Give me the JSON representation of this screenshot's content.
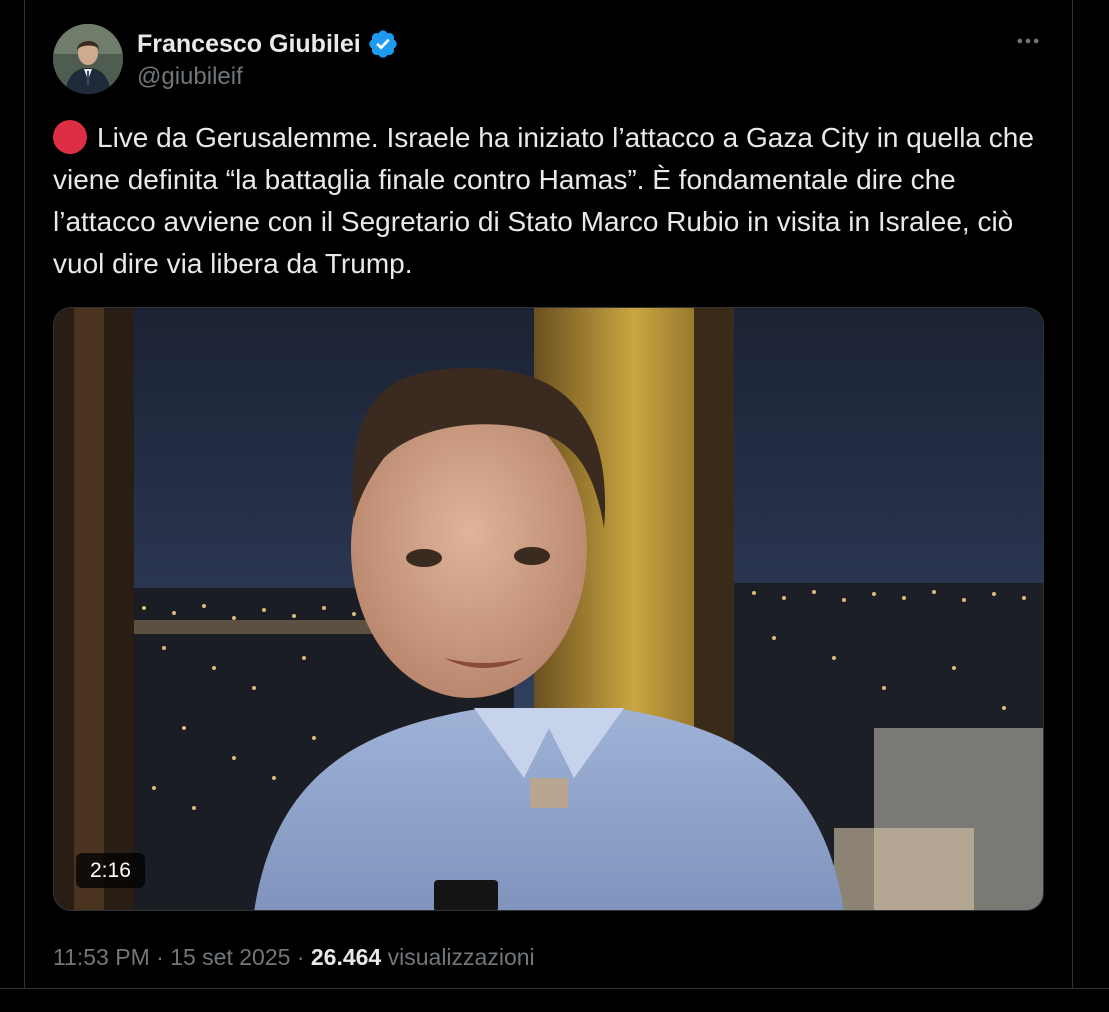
{
  "author": {
    "name": "Francesco Giubilei",
    "handle": "@giubileif",
    "verified": true
  },
  "post": {
    "text": "Live da Gerusalemme. Israele ha iniziato l’attacco a Gaza City in quella che viene definita “la battaglia finale contro Hamas”. È fondamentale dire che l’attacco avviene con il Segretario di Stato Marco Rubio in visita in Isralee, ciò vuol dire via libera da Trump.",
    "leading_emoji": "red-circle",
    "video": {
      "duration": "2:16"
    },
    "time": "11:53 PM",
    "date": "15 set 2025",
    "separator": "·",
    "views_count": "26.464",
    "views_label": "visualizzazioni"
  },
  "icons": {
    "more": "more-horizontal-icon",
    "verified": "verified-badge-icon"
  },
  "colors": {
    "background": "#000000",
    "text_primary": "#e7e9ea",
    "text_secondary": "#71767b",
    "verified_blue": "#1d9bf0",
    "red_dot": "#dd2e44",
    "border": "#2f3336"
  }
}
